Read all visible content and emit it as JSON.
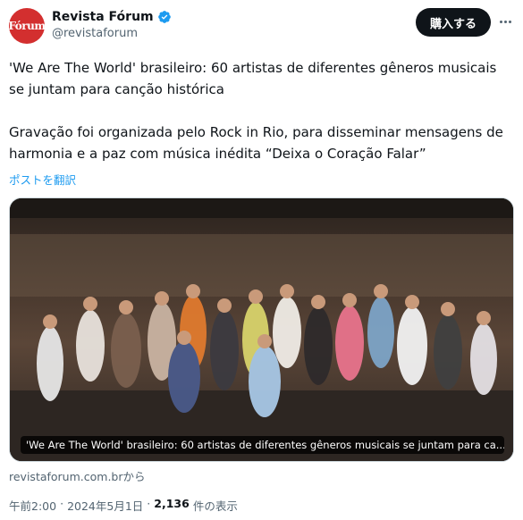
{
  "author": {
    "name": "Revista Fórum",
    "handle": "@revistaforum",
    "avatar_text": "Fórum",
    "avatar_color": "#d32f2f"
  },
  "buy_button": "購入する",
  "post": {
    "text": "'We Are The World' brasileiro: 60 artistas de diferentes gêneros musicais se juntam para canção histórica\n\nGravação foi organizada pelo Rock in Rio, para  disseminar mensagens de harmonia e a paz com música inédita “Deixa o  Coração Falar”",
    "translate_label": "ポストを翻訳"
  },
  "media": {
    "caption": "'We Are The World' brasileiro: 60 artistas de diferentes gêneros musicais se juntam para ca..."
  },
  "link_source": "revistaforum.com.brから",
  "meta": {
    "time": "午前2:00",
    "date": "2024年5月1日",
    "views_count": "2,136",
    "views_label": "件の表示",
    "separator": "·"
  },
  "colors": {
    "link": "#1d9bf0",
    "secondary": "#536471",
    "button_bg": "#0f1419"
  }
}
